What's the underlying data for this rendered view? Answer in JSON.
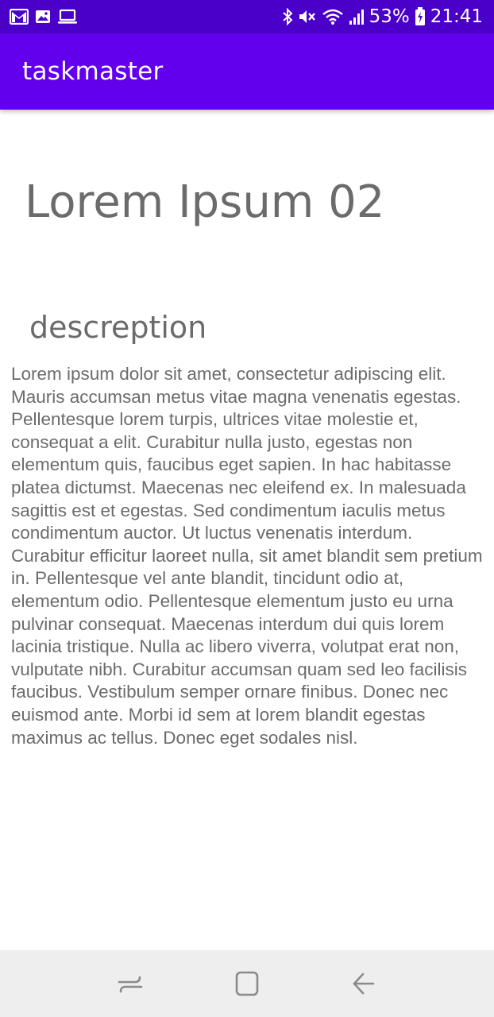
{
  "status_bar": {
    "left_icons": [
      "gmail-icon",
      "gallery-icon",
      "laptop-icon"
    ],
    "right_icons": [
      "bluetooth-icon",
      "mute-icon",
      "wifi-icon",
      "signal-icon",
      "battery-charging-icon"
    ],
    "battery": "53%",
    "time": "21:41"
  },
  "app_bar": {
    "title": "taskmaster",
    "color": "#6200ee"
  },
  "task": {
    "title": "Lorem Ipsum 02",
    "description_heading": "descreption",
    "description": "Lorem ipsum dolor sit amet, consectetur adipiscing elit. Mauris accumsan metus vitae magna venenatis egestas. Pellentesque lorem turpis, ultrices vitae molestie et, consequat a elit. Curabitur nulla justo, egestas non elementum quis, faucibus eget sapien. In hac habitasse platea dictumst. Maecenas nec eleifend ex. In malesuada sagittis est et egestas. Sed condimentum iaculis metus condimentum auctor. Ut luctus venenatis interdum. Curabitur efficitur laoreet nulla, sit amet blandit sem pretium in. Pellentesque vel ante blandit, tincidunt odio at, elementum odio. Pellentesque elementum justo eu urna pulvinar consequat. Maecenas interdum dui quis lorem lacinia tristique. Nulla ac libero viverra, volutpat erat non, vulputate nibh. Curabitur accumsan quam sed leo facilisis faucibus. Vestibulum semper ornare finibus. Donec nec euismod ante. Morbi id sem at lorem blandit egestas maximus ac tellus. Donec eget sodales nisl."
  },
  "nav_bar": {
    "buttons": [
      "recents-icon",
      "home-icon",
      "back-icon"
    ]
  }
}
